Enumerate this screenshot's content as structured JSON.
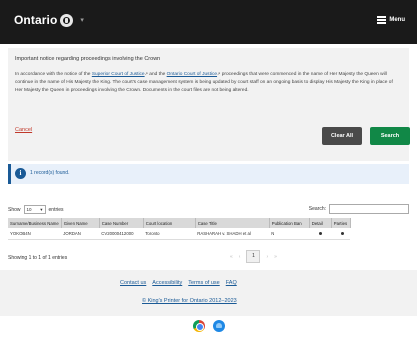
{
  "header": {
    "logo_text": "Ontario",
    "menu_label": "Menu",
    "icons": [
      "ontario-trillium-icon",
      "chevron-down-icon",
      "hamburger-icon"
    ]
  },
  "notice": {
    "title": "Important notice regarding proceedings involving the Crown",
    "body_part1": "In accordance with the notice of the ",
    "link1": "Superior Court of Justice",
    "body_part2": " and the ",
    "link2": "Ontario Court of Justice",
    "body_part3": " proceedings that were commenced in the name of Her Majesty the Queen will continue in the name of His Majesty the King. The court's case management system is being updated by court staff on an ongoing basis to display His Majesty the King in place of Her Majesty the Queen in proceedings involving the Crown. Documents in the court files are not being altered.",
    "cancel_label": "Cancel",
    "clear_label": "Clear All",
    "search_label": "Search"
  },
  "result": {
    "text": "1 record(s) found."
  },
  "table_controls": {
    "show_label": "Show",
    "show_value": "10",
    "entries_label": "entries",
    "search_label": "Search:"
  },
  "table": {
    "columns": [
      "Surname/Business Name",
      "Given Name",
      "Case Number",
      "Court location",
      "Case Title",
      "Publication Ban",
      "Detail",
      "Parties"
    ],
    "rows": [
      [
        "YOKOB4N",
        "JORDAN",
        "CV20000412000",
        "Toronto",
        "RASHARAH v. SHADH et al",
        "N",
        "",
        ""
      ]
    ]
  },
  "pagination": {
    "showing_text": "Showing 1 to 1 of 1 entries",
    "prev": "‹",
    "prev_first": "«",
    "current": "1",
    "next": "›",
    "next_last": "»"
  },
  "footer": {
    "links": [
      "Contact us",
      "Accessibility",
      "Terms of use",
      "FAQ"
    ],
    "copyright": "© King's Printer for Ontario 2012–2023"
  },
  "colors": {
    "header_bg": "#1a1a1a",
    "search_button": "#118847",
    "clear_button": "#4a4a4a",
    "link": "#1a5a96",
    "cancel": "#c0392b"
  }
}
